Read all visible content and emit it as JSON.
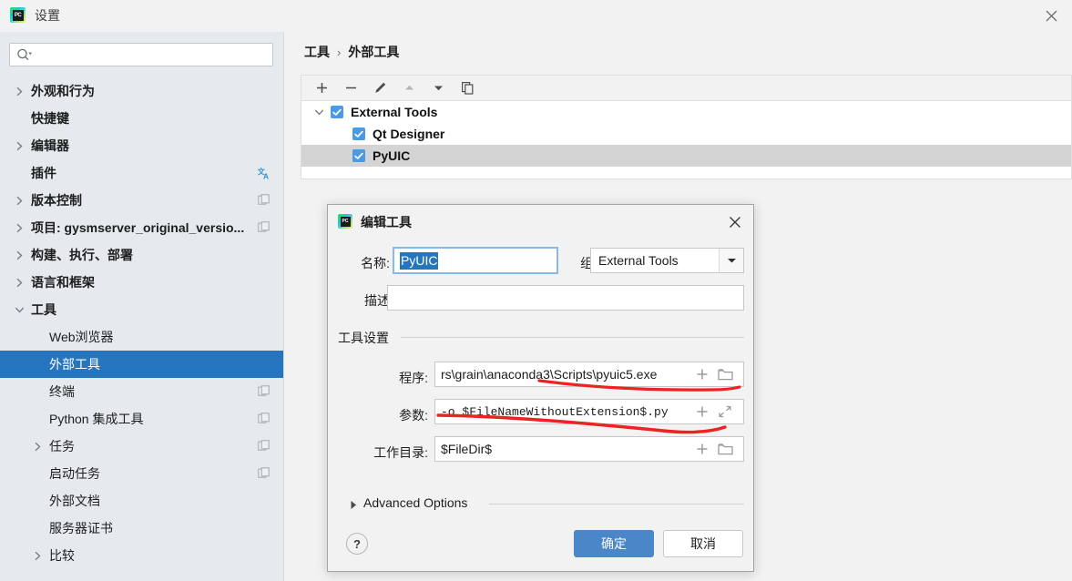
{
  "window": {
    "title": "设置",
    "icon": "pycharm-icon",
    "icon_text": "PC",
    "close_icon": "close-icon"
  },
  "sidebar": {
    "search": {
      "placeholder": "",
      "value": "",
      "icon": "search-dropdown-icon"
    },
    "items": [
      {
        "label": "外观和行为",
        "indent": 1,
        "chevron": "right",
        "badge": "",
        "selected": false,
        "bold": true
      },
      {
        "label": "快捷键",
        "indent": 1,
        "chevron": "",
        "badge": "",
        "selected": false,
        "bold": true
      },
      {
        "label": "编辑器",
        "indent": 1,
        "chevron": "right",
        "badge": "",
        "selected": false,
        "bold": true
      },
      {
        "label": "插件",
        "indent": 1,
        "chevron": "",
        "badge": "translate-icon",
        "selected": false,
        "bold": true
      },
      {
        "label": "版本控制",
        "indent": 1,
        "chevron": "right",
        "badge": "project-scope-icon",
        "selected": false,
        "bold": true
      },
      {
        "label": "项目: gysmserver_original_versio...",
        "indent": 1,
        "chevron": "right",
        "badge": "project-scope-icon",
        "selected": false,
        "bold": true
      },
      {
        "label": "构建、执行、部署",
        "indent": 1,
        "chevron": "right",
        "badge": "",
        "selected": false,
        "bold": true
      },
      {
        "label": "语言和框架",
        "indent": 1,
        "chevron": "right",
        "badge": "",
        "selected": false,
        "bold": true
      },
      {
        "label": "工具",
        "indent": 1,
        "chevron": "down",
        "badge": "",
        "selected": false,
        "bold": true
      },
      {
        "label": "Web浏览器",
        "indent": 2,
        "chevron": "",
        "badge": "",
        "selected": false,
        "bold": false
      },
      {
        "label": "外部工具",
        "indent": 2,
        "chevron": "",
        "badge": "",
        "selected": true,
        "bold": false
      },
      {
        "label": "终端",
        "indent": 2,
        "chevron": "",
        "badge": "project-scope-icon",
        "selected": false,
        "bold": false
      },
      {
        "label": "Python 集成工具",
        "indent": 2,
        "chevron": "",
        "badge": "project-scope-icon",
        "selected": false,
        "bold": false
      },
      {
        "label": "任务",
        "indent": 2,
        "chevron": "right",
        "badge": "project-scope-icon",
        "selected": false,
        "bold": false
      },
      {
        "label": "启动任务",
        "indent": 2,
        "chevron": "",
        "badge": "project-scope-icon",
        "selected": false,
        "bold": false
      },
      {
        "label": "外部文档",
        "indent": 2,
        "chevron": "",
        "badge": "",
        "selected": false,
        "bold": false
      },
      {
        "label": "服务器证书",
        "indent": 2,
        "chevron": "",
        "badge": "",
        "selected": false,
        "bold": false
      },
      {
        "label": "比较",
        "indent": 2,
        "chevron": "right",
        "badge": "",
        "selected": false,
        "bold": false
      }
    ]
  },
  "main": {
    "breadcrumb": {
      "parent": "工具",
      "separator": "›",
      "current": "外部工具"
    },
    "toolbar": [
      {
        "name": "add-button",
        "glyph": "+",
        "disabled": false
      },
      {
        "name": "remove-button",
        "glyph": "−",
        "disabled": false
      },
      {
        "name": "edit-button",
        "glyph": "pencil",
        "disabled": false
      },
      {
        "name": "move-up-button",
        "glyph": "triangle-up",
        "disabled": true
      },
      {
        "name": "move-down-button",
        "glyph": "triangle-down",
        "disabled": false
      },
      {
        "name": "copy-button",
        "glyph": "copy",
        "disabled": false
      }
    ],
    "tool_tree": [
      {
        "label": "External Tools",
        "level": 1,
        "checked": true,
        "chevron": "down",
        "selected": false
      },
      {
        "label": "Qt Designer",
        "level": 2,
        "checked": true,
        "chevron": "",
        "selected": false
      },
      {
        "label": "PyUIC",
        "level": 2,
        "checked": true,
        "chevron": "",
        "selected": true
      }
    ]
  },
  "dialog": {
    "title": "编辑工具",
    "icon": "pycharm-icon",
    "icon_text": "PC",
    "close_icon": "close-icon",
    "name_label": "名称:",
    "name_value": "PyUIC",
    "group_label": "组:",
    "group_value": "External Tools",
    "desc_label": "描述",
    "desc_value": "",
    "settings_group_title": "工具设置",
    "program_label": "程序:",
    "program_value": "rs\\grain\\anaconda3\\Scripts\\pyuic5.exe",
    "parameters_label": "参数:",
    "parameters_value": "-o $FileNameWithoutExtension$.py",
    "workdir_label": "工作目录:",
    "workdir_value": "$FileDir$",
    "advanced_options_label": "Advanced Options",
    "help_label": "?",
    "ok_label": "确定",
    "cancel_label": "取消",
    "field_icons": {
      "insert_macro": "plus-icon",
      "browse": "folder-icon",
      "expand": "expand-icon"
    }
  },
  "annotations": {
    "color": "#ee2222",
    "marks": [
      {
        "name": "red-underline-program"
      },
      {
        "name": "red-underline-parameters"
      }
    ]
  },
  "colors": {
    "accent_blue": "#2675bf",
    "checkbox_blue": "#4a9ae8",
    "primary_button": "#4a86c8",
    "sidebar_bg": "#e6eaef",
    "panel_bg": "#f2f2f2",
    "annotation_red": "#ee2222"
  }
}
